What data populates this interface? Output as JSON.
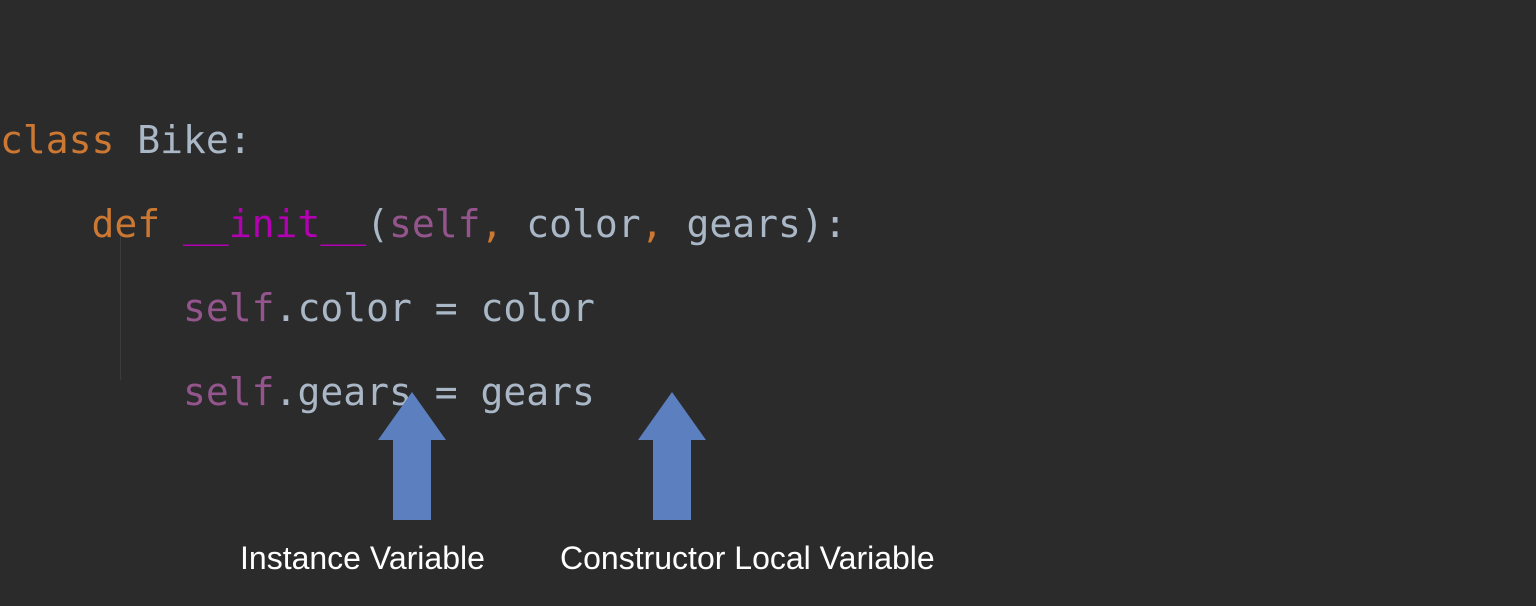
{
  "code": {
    "line1": {
      "kw_class": "class",
      "space1": " ",
      "classname": "Bike",
      "colon": ":"
    },
    "line2": {
      "indent": "    ",
      "kw_def": "def",
      "space1": " ",
      "dunder": "__init__",
      "lparen": "(",
      "self": "self",
      "comma1": ",",
      "space2": " ",
      "param1": "color",
      "comma2": ",",
      "space3": " ",
      "param2": "gears",
      "rparen": ")",
      "colon": ":"
    },
    "line3": {
      "indent": "        ",
      "self": "self",
      "dot": ".",
      "attr": "color",
      "space1": " ",
      "eq": "=",
      "space2": " ",
      "rhs": "color"
    },
    "line4": {
      "indent": "        ",
      "self": "self",
      "dot": ".",
      "attr": "gears",
      "space1": " ",
      "eq": "=",
      "space2": " ",
      "rhs": "gears"
    }
  },
  "annotations": {
    "left_label": "Instance Variable",
    "right_label": "Constructor Local Variable"
  },
  "colors": {
    "background": "#2b2b2b",
    "keyword": "#cc7832",
    "dunder": "#b200b2",
    "self": "#94558d",
    "identifier": "#a9b7c6",
    "arrow": "#5b7fbf",
    "label": "#ffffff"
  }
}
